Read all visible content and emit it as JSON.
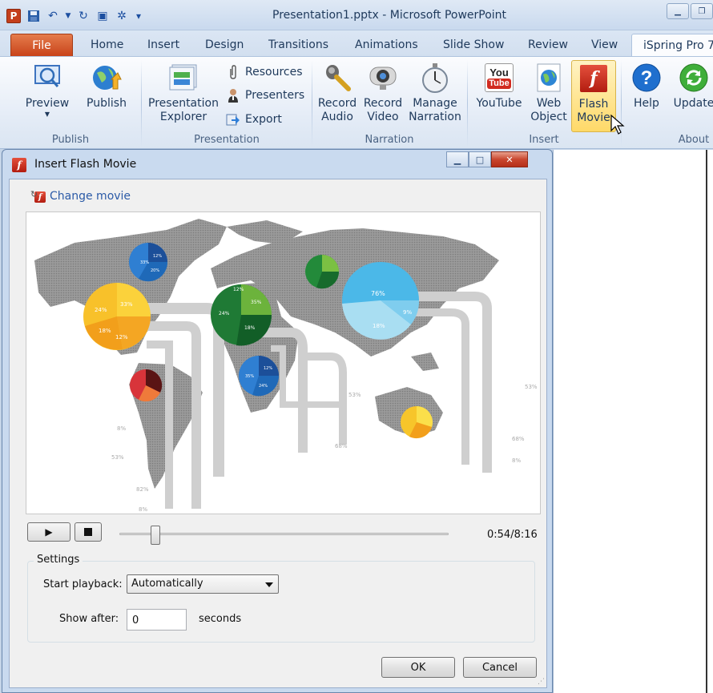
{
  "window": {
    "title": "Presentation1.pptx - Microsoft PowerPoint",
    "app_icon_letter": "P"
  },
  "ribbon_tabs": [
    "File",
    "Home",
    "Insert",
    "Design",
    "Transitions",
    "Animations",
    "Slide Show",
    "Review",
    "View",
    "iSpring Pro 7"
  ],
  "ribbon": {
    "publish_group": {
      "label": "Publish",
      "preview": "Preview",
      "publish": "Publish"
    },
    "presentation_group": {
      "label": "Presentation",
      "explorer_line1": "Presentation",
      "explorer_line2": "Explorer",
      "resources": "Resources",
      "presenters": "Presenters",
      "export": "Export"
    },
    "narration_group": {
      "label": "Narration",
      "record_audio_1": "Record",
      "record_audio_2": "Audio",
      "record_video_1": "Record",
      "record_video_2": "Video",
      "manage_narration_1": "Manage",
      "manage_narration_2": "Narration"
    },
    "insert_group": {
      "label": "Insert",
      "youtube": "YouTube",
      "youtube_icon_top": "You",
      "youtube_icon_bottom": "Tube",
      "web_object_1": "Web",
      "web_object_2": "Object",
      "flash_movie_1": "Flash",
      "flash_movie_2": "Movie"
    },
    "about_group": {
      "label": "About",
      "help": "Help",
      "update": "Update"
    }
  },
  "dialog": {
    "title": "Insert Flash Movie",
    "change_movie": "Change movie",
    "player": {
      "time": "0:54/8:16",
      "progress": 0.11
    },
    "settings": {
      "legend": "Settings",
      "start_playback_label": "Start playback:",
      "start_playback_value": "Automatically",
      "show_after_label": "Show after:",
      "show_after_value": "0",
      "seconds_label": "seconds"
    },
    "ok": "OK",
    "cancel": "Cancel"
  },
  "map": {
    "pies": [
      {
        "labels": [
          "33%",
          "12%",
          "20%"
        ]
      },
      {
        "labels": [
          "24%",
          "33%",
          "18%",
          "12%"
        ]
      },
      {
        "labels": [
          "12%",
          "35%",
          "24%",
          "18%"
        ]
      },
      {
        "labels": [
          "76%",
          "9%",
          "18%"
        ]
      },
      {
        "labels": [
          "35%",
          "12%",
          "24%"
        ]
      }
    ],
    "flow_labels": [
      "53%",
      "53%",
      "8%",
      "68%",
      "53%",
      "82%",
      "8%",
      "68%",
      "8%"
    ],
    "colors": {
      "land": "#8a8a8a",
      "flow": "#cfcfcf",
      "yellow": "#f6b524",
      "green": "#2f8f3a",
      "blue": "#1e6fc1",
      "cyan": "#3fb2e5",
      "red": "#c0282d"
    }
  }
}
